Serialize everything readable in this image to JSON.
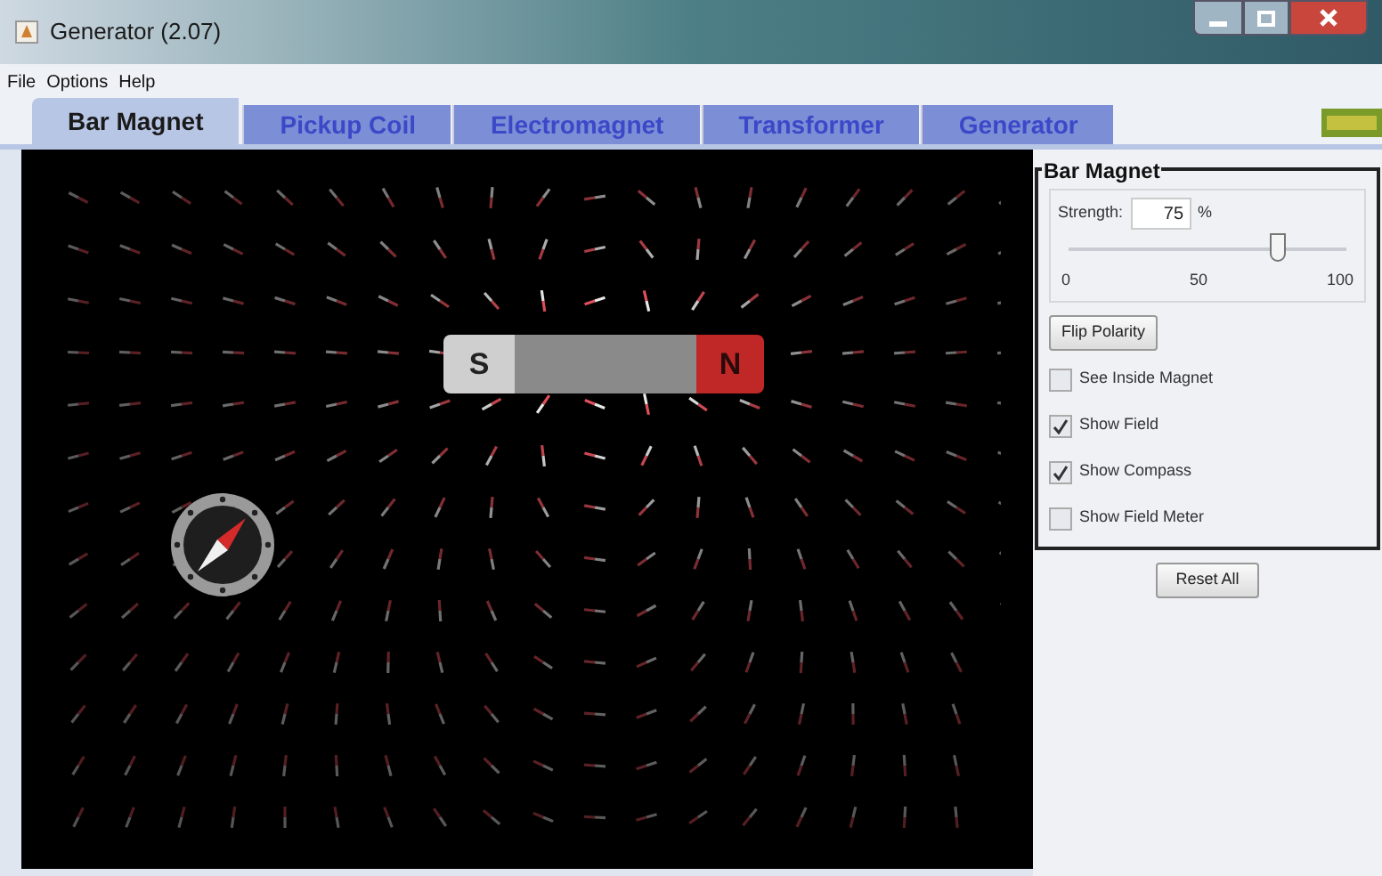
{
  "window": {
    "title": "Generator (2.07)"
  },
  "menu": [
    "File",
    "Options",
    "Help"
  ],
  "tabs": [
    {
      "label": "Bar Magnet",
      "selected": true
    },
    {
      "label": "Pickup Coil",
      "selected": false
    },
    {
      "label": "Electromagnet",
      "selected": false
    },
    {
      "label": "Transformer",
      "selected": false
    },
    {
      "label": "Generator",
      "selected": false
    }
  ],
  "magnet": {
    "south_label": "S",
    "north_label": "N"
  },
  "panel": {
    "title": "Bar Magnet",
    "strength_label": "Strength:",
    "strength_value": "75",
    "strength_unit": "%",
    "slider": {
      "level": 0.75,
      "ticks": [
        "0",
        "50",
        "100"
      ]
    },
    "flip_button": "Flip Polarity",
    "options": [
      {
        "label": "See Inside Magnet",
        "checked": false
      },
      {
        "label": "Show Field",
        "checked": true
      },
      {
        "label": "Show Compass",
        "checked": true
      },
      {
        "label": "Show Field Meter",
        "checked": false
      }
    ]
  },
  "reset_button": "Reset All"
}
